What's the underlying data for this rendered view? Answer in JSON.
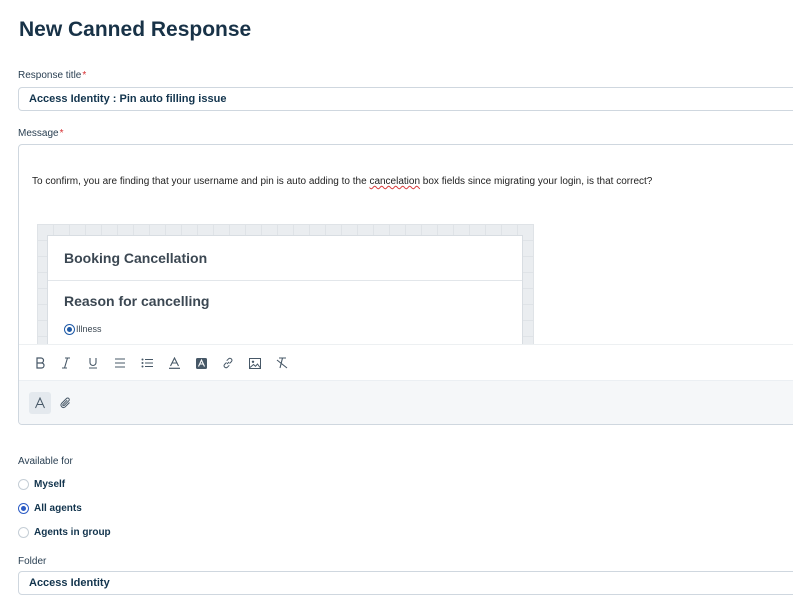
{
  "page": {
    "title": "New Canned Response"
  },
  "response_title": {
    "label": "Response title",
    "required_mark": "*",
    "value": "Access Identity : Pin auto filling issue"
  },
  "message": {
    "label": "Message",
    "required_mark": "*",
    "text_before": "To confirm, you are finding that your username and pin is auto adding to the ",
    "text_misspelled": "cancelation",
    "text_after": " box fields since migrating your login, is that correct?",
    "embedded_image": {
      "heading": "Booking Cancellation",
      "subheading": "Reason for cancelling",
      "selected_option": "Illness"
    },
    "toolbar": [
      "bold-icon",
      "italic-icon",
      "underline-icon",
      "ordered-list-icon",
      "unordered-list-icon",
      "text-color-icon",
      "highlight-color-icon",
      "link-icon",
      "insert-image-icon",
      "clear-format-icon"
    ],
    "footer": [
      "font-icon",
      "attachment-icon"
    ]
  },
  "available_for": {
    "label": "Available for",
    "options": [
      {
        "label": "Myself",
        "selected": false
      },
      {
        "label": "All agents",
        "selected": true
      },
      {
        "label": "Agents in group",
        "selected": false
      }
    ]
  },
  "folder": {
    "label": "Folder",
    "value": "Access Identity"
  },
  "colors": {
    "accent": "#2c5cc5",
    "required": "#d72d30",
    "text": "#12344d"
  }
}
